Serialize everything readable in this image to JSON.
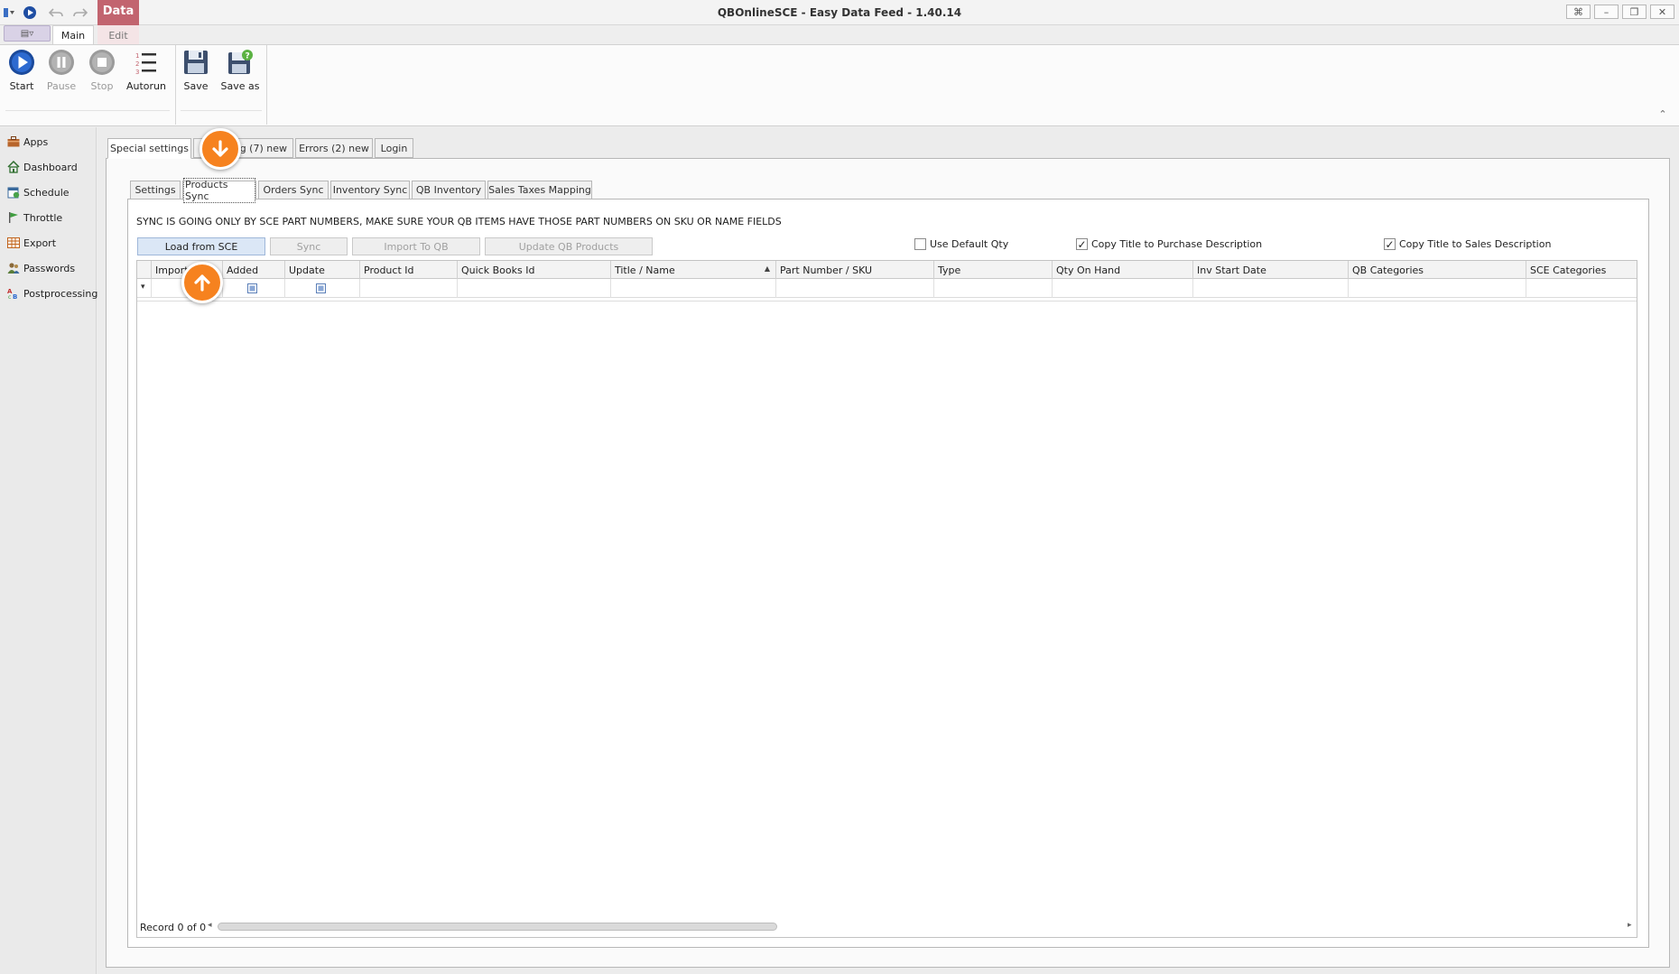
{
  "window": {
    "title": "QBOnlineSCE - Easy Data Feed - 1.40.14",
    "controls": [
      "restore-icon",
      "minimize-icon",
      "maximize-icon",
      "close-icon"
    ]
  },
  "ribbon": {
    "context_tab": "Data",
    "tabs": [
      {
        "label": "Main",
        "active": true
      },
      {
        "label": "Edit",
        "active": false
      }
    ],
    "buttons": [
      {
        "label": "Start",
        "icon": "play-icon",
        "enabled": true
      },
      {
        "label": "Pause",
        "icon": "pause-icon",
        "enabled": false
      },
      {
        "label": "Stop",
        "icon": "stop-icon",
        "enabled": false
      },
      {
        "label": "Autorun",
        "icon": "list-icon",
        "enabled": true
      },
      {
        "label": "Save",
        "icon": "floppy-icon",
        "enabled": true
      },
      {
        "label": "Save as",
        "icon": "floppy-plus-icon",
        "enabled": true
      }
    ]
  },
  "sidebar": {
    "items": [
      {
        "label": "Apps",
        "icon": "briefcase-icon"
      },
      {
        "label": "Dashboard",
        "icon": "house-icon"
      },
      {
        "label": "Schedule",
        "icon": "calendar-icon"
      },
      {
        "label": "Throttle",
        "icon": "flag-icon"
      },
      {
        "label": "Export",
        "icon": "table-icon"
      },
      {
        "label": "Passwords",
        "icon": "users-icon"
      },
      {
        "label": "Postprocessing",
        "icon": "abc-icon"
      }
    ]
  },
  "outer_tabs": [
    {
      "label": "Special settings",
      "active": true
    },
    {
      "label": "Log (7) new",
      "visible_part": "g (7) new",
      "active": false
    },
    {
      "label": "Errors (2) new",
      "active": false
    },
    {
      "label": "Login",
      "active": false
    }
  ],
  "inner_tabs": [
    {
      "label": "Settings",
      "active": false
    },
    {
      "label": "Products Sync",
      "active": true
    },
    {
      "label": "Orders Sync",
      "active": false
    },
    {
      "label": "Inventory Sync",
      "active": false
    },
    {
      "label": "QB Inventory",
      "active": false
    },
    {
      "label": "Sales Taxes Mapping",
      "active": false
    }
  ],
  "products_sync": {
    "notice": "SYNC IS GOING ONLY BY SCE PART NUMBERS, MAKE SURE YOUR QB ITEMS HAVE THOSE PART NUMBERS ON SKU OR NAME FIELDS",
    "buttons": [
      {
        "label": "Load from SCE",
        "enabled": true
      },
      {
        "label": "Sync",
        "enabled": false
      },
      {
        "label": "Import To QB",
        "enabled": false
      },
      {
        "label": "Update QB Products",
        "enabled": false
      }
    ],
    "checkboxes": [
      {
        "label": "Use Default Qty",
        "checked": false
      },
      {
        "label": "Copy Title to Purchase Description",
        "checked": true
      },
      {
        "label": "Copy Title to Sales Description",
        "checked": true
      }
    ],
    "grid": {
      "columns": [
        "Import",
        "Added",
        "Update",
        "Product Id",
        "Quick Books Id",
        "Title / Name",
        "Part Number / SKU",
        "Type",
        "Qty On Hand",
        "Inv Start Date",
        "QB Categories",
        "SCE Categories"
      ],
      "sorted_column": "Title / Name",
      "sort_direction": "ascending",
      "rows": [],
      "record_info": "Record 0 of 0"
    }
  },
  "markers": [
    {
      "icon": "arrow-down-icon",
      "color": "#f6821f"
    },
    {
      "icon": "arrow-up-icon",
      "color": "#f6821f"
    }
  ],
  "colors": {
    "accent": "#f6821f",
    "context_tab": "#c2646f",
    "ribbon_bg": "#fbfbfb",
    "primary_button": "#dbe7f6"
  }
}
